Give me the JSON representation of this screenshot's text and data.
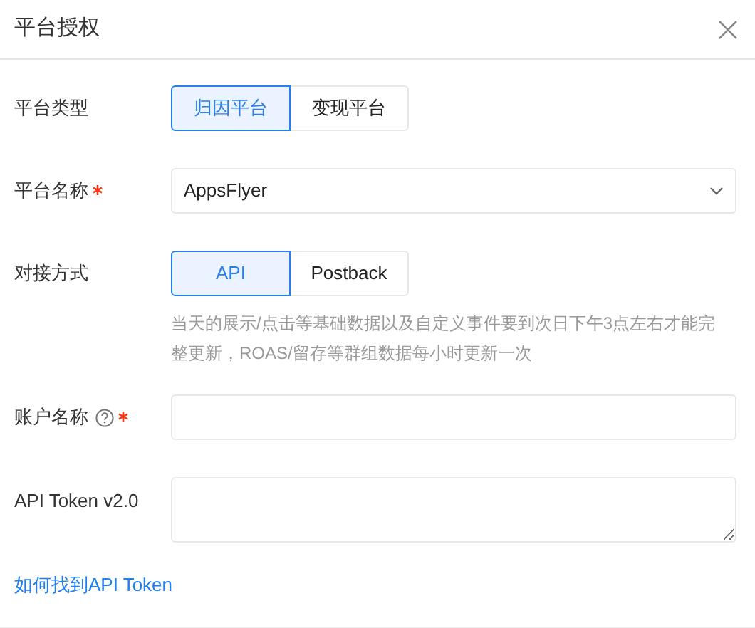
{
  "dialog": {
    "title": "平台授权"
  },
  "fields": [
    {
      "kind": "segmented",
      "label": "平台类型",
      "required": false,
      "help": false,
      "options": [
        {
          "label": "归因平台",
          "selected": true
        },
        {
          "label": "变现平台",
          "selected": false
        }
      ]
    },
    {
      "kind": "select",
      "label": "平台名称",
      "required": true,
      "help": false,
      "value": "AppsFlyer"
    },
    {
      "kind": "segmented",
      "label": "对接方式",
      "required": false,
      "help": false,
      "options": [
        {
          "label": "API",
          "selected": true
        },
        {
          "label": "Postback",
          "selected": false
        }
      ],
      "note": "当天的展示/点击等基础数据以及自定义事件要到次日下午3点左右才能完整更新，ROAS/留存等群组数据每小时更新一次"
    },
    {
      "kind": "input",
      "label": "账户名称",
      "required": true,
      "help": true
    },
    {
      "kind": "textarea",
      "label": "API Token v2.0",
      "required": false,
      "help": false
    }
  ],
  "link": "如何找到API Token"
}
